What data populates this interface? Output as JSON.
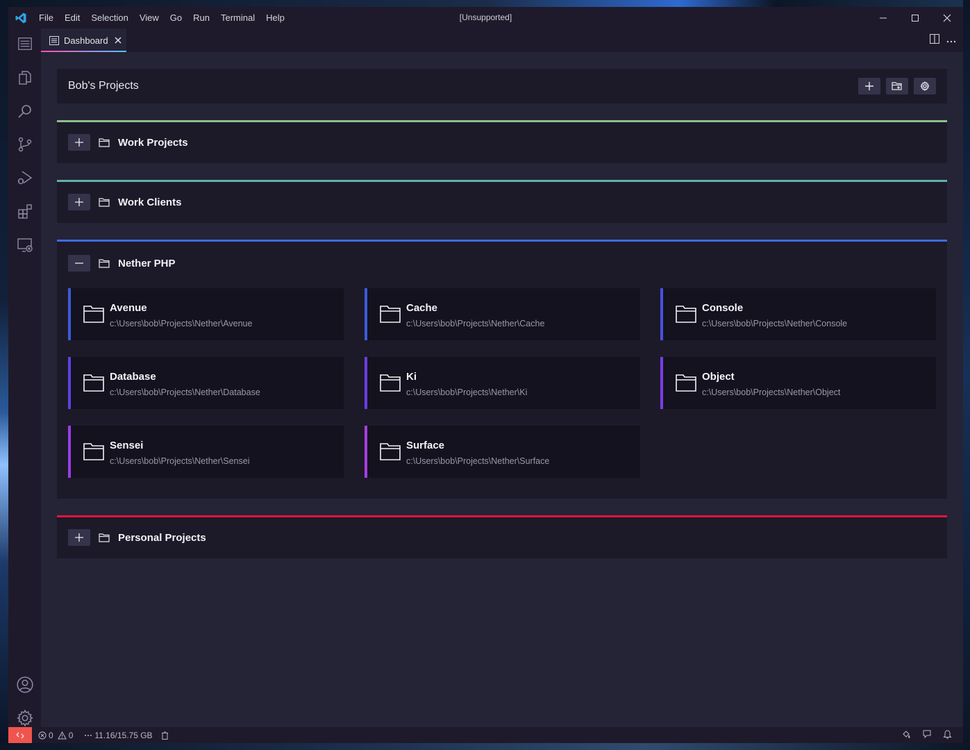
{
  "window": {
    "title": "[Unsupported]",
    "menu": [
      "File",
      "Edit",
      "Selection",
      "View",
      "Go",
      "Run",
      "Terminal",
      "Help"
    ]
  },
  "tab": {
    "label": "Dashboard"
  },
  "dashboard": {
    "title": "Bob's Projects"
  },
  "groups": [
    {
      "title": "Work Projects",
      "color": "#8fbf8a",
      "expanded": false
    },
    {
      "title": "Work Clients",
      "color": "#5fb3a4",
      "expanded": false
    },
    {
      "title": "Nether PHP",
      "color": "#4169e1",
      "expanded": true,
      "projects": [
        {
          "name": "Avenue",
          "path": "c:\\Users\\bob\\Projects\\Nether\\Avenue"
        },
        {
          "name": "Cache",
          "path": "c:\\Users\\bob\\Projects\\Nether\\Cache"
        },
        {
          "name": "Console",
          "path": "c:\\Users\\bob\\Projects\\Nether\\Console"
        },
        {
          "name": "Database",
          "path": "c:\\Users\\bob\\Projects\\Nether\\Database"
        },
        {
          "name": "Ki",
          "path": "c:\\Users\\bob\\Projects\\Nether\\Ki"
        },
        {
          "name": "Object",
          "path": "c:\\Users\\bob\\Projects\\Nether\\Object"
        },
        {
          "name": "Sensei",
          "path": "c:\\Users\\bob\\Projects\\Nether\\Sensei"
        },
        {
          "name": "Surface",
          "path": "c:\\Users\\bob\\Projects\\Nether\\Surface"
        }
      ]
    },
    {
      "title": "Personal Projects",
      "color": "#e0143c",
      "expanded": false
    }
  ],
  "statusbar": {
    "errors": "0",
    "warnings": "0",
    "memory": "11.16/15.75 GB"
  },
  "colors": {
    "accent_remote": "#f0554d",
    "tab_underline_start": "#ff4fb2",
    "tab_underline_end": "#4fc3ff",
    "card_border_blue": "#3b5bdb",
    "card_border_purple": "#7a3de8",
    "card_border_violet": "#a63ee0"
  },
  "icons": {
    "activity": [
      "dashboard-icon",
      "explorer-icon",
      "search-icon",
      "source-control-icon",
      "run-debug-icon",
      "extensions-icon",
      "remote-explorer-icon",
      "account-icon",
      "settings-gear-icon"
    ]
  }
}
